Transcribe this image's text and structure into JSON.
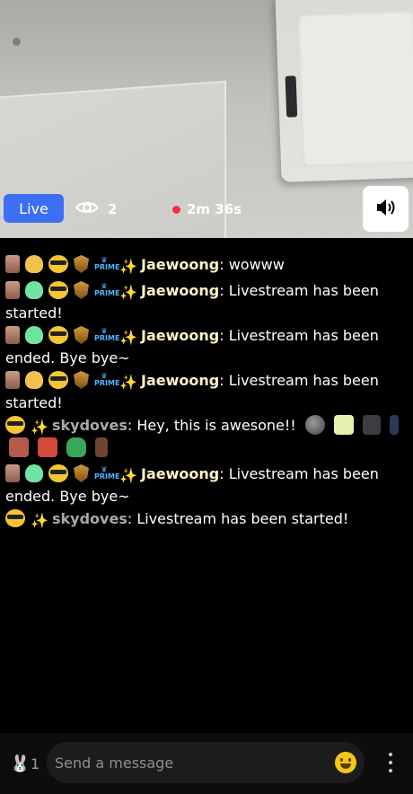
{
  "stream": {
    "live_label": "Live",
    "viewer_count": "2",
    "duration": "2m 36s"
  },
  "chat": {
    "messages": [
      {
        "user": "Jaewoong",
        "text": "wowww"
      },
      {
        "user": "Jaewoong",
        "text": "Livestream has been started!"
      },
      {
        "user": "Jaewoong",
        "text": "Livestream has been ended. Bye bye~"
      },
      {
        "user": "Jaewoong",
        "text": "Livestream has been started!"
      },
      {
        "user": "skydoves",
        "text": "Hey, this is awesone!!"
      },
      {
        "user": "Jaewoong",
        "text": "Livestream has been ended. Bye bye~"
      },
      {
        "user": "skydoves",
        "text": "Livestream has been started!"
      }
    ],
    "separator": ": "
  },
  "composer": {
    "reaction_count": "1",
    "placeholder": "Send a message"
  },
  "colors": {
    "live_badge": "#3d6ff5",
    "recording_dot": "#ff2d44",
    "username_primary": "#fff4c8",
    "username_secondary": "#a9a9a9",
    "background": "#000000"
  },
  "icons": {
    "viewers": "eye-icon",
    "volume": "speaker-icon",
    "reaction": "rabbit-icon",
    "emoji": "smiley-icon",
    "menu": "more-vertical-icon"
  }
}
